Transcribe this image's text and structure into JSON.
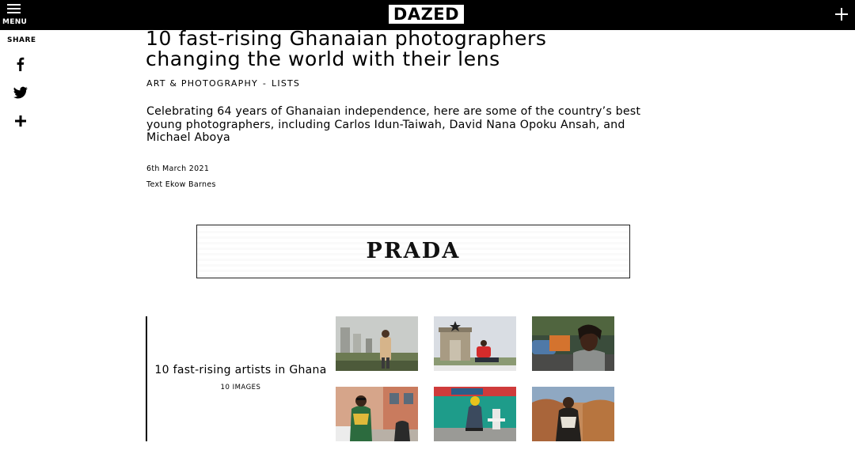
{
  "header": {
    "menu_label": "MENU",
    "logo": "DAZED"
  },
  "share": {
    "label": "SHARE",
    "icons": [
      "facebook-icon",
      "twitter-icon",
      "plus-icon"
    ]
  },
  "article": {
    "title": "10 fast-rising Ghanaian photographers changing the world with their lens",
    "category": "ART & PHOTOGRAPHY",
    "separator": "-",
    "type": "LISTS",
    "standfirst": "Celebrating 64 years of Ghanaian independence, here are some of the country’s best young photographers, including Carlos Idun-Taiwah, David Nana Opoku Ansah, and Michael Aboya",
    "date": "6th March 2021",
    "byline_prefix": "Text",
    "author": "Ekow Barnes"
  },
  "ad": {
    "brand": "PRADA"
  },
  "gallery": {
    "title": "10 fast-rising artists in Ghana",
    "count": "10 IMAGES"
  },
  "colors": {
    "topbar": "#000000",
    "text": "#000000",
    "background": "#ffffff"
  }
}
